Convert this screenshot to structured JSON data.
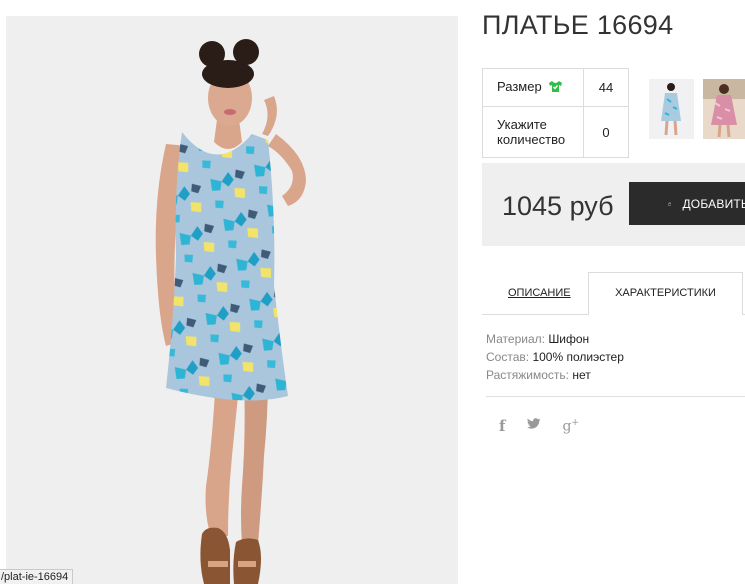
{
  "product": {
    "title": "ПЛАТЬЕ 16694",
    "image_alt": "Платье 16694"
  },
  "properties": [
    {
      "label": "Размер",
      "value": "44"
    },
    {
      "label": "Укажите количество",
      "value": "0"
    }
  ],
  "purchase": {
    "price": "1045 руб",
    "add_button_label": "ДОБАВИТЬ"
  },
  "tabs": [
    {
      "label": "ОПИСАНИЕ",
      "active": false
    },
    {
      "label": "ХАРАКТЕРИСТИКИ",
      "active": true
    }
  ],
  "specs": [
    {
      "label": "Материал:",
      "value": "Шифон"
    },
    {
      "label": "Состав:",
      "value": "100% полиэстер"
    },
    {
      "label": "Растяжимость:",
      "value": "нет"
    }
  ],
  "social": [
    "facebook-icon",
    "twitter-icon",
    "google-plus-icon"
  ],
  "status_bar": {
    "url": "/plat-ie-16694"
  },
  "colors": {
    "accent_button": "#2b2b2b",
    "size_icon": "#2fbe4a",
    "buy_box_bg": "#efefef",
    "dress_blue": "#a9cbe0"
  }
}
